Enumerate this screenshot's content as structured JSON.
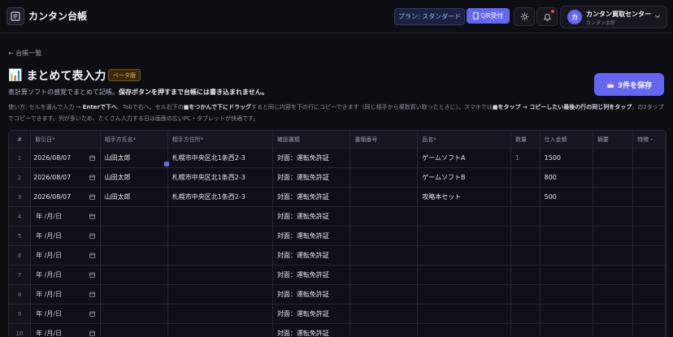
{
  "app": {
    "title": "カンタン台帳"
  },
  "header": {
    "plan_label": "プラン: スタンダード",
    "qr_label": "QR受付",
    "account_name": "カンタン買取センター",
    "account_sub": "カンタン太郎",
    "avatar_letter": "カ"
  },
  "nav": {
    "back_label": "← 台帳一覧"
  },
  "page": {
    "emoji": "📊",
    "title": "まとめて表入力",
    "beta_label": "ベータ版",
    "lead_prefix": "表計算ソフトの感覚でまとめて記帳。",
    "lead_bold": "保存ボタンを押すまで台帳には書き込まれません。",
    "save_label": "3件を保存"
  },
  "usage": {
    "p1": "使い方: セルを選んで入力 → ",
    "b1": "Enterで下へ",
    "p2": "、Tabで右へ。セル右下の",
    "b2": "■をつかんで下にドラッグ",
    "p3": "すると同じ内容を下の行にコピーできます（同じ相手から複数買い取ったときに）。スマホでは",
    "b3": "■をタップ → コピーしたい最後の行の同じ列をタップ",
    "p4": "。の2タップでコピーできます。列が多いため、たくさん入力する日は画面の広いPC・タブレットが快適です。"
  },
  "grid": {
    "columns": [
      "#",
      "取引日*",
      "相手方氏名*",
      "相手方住所*",
      "確認書類",
      "書類番号",
      "品名*",
      "数量",
      "仕入金額",
      "摘要",
      "特徴・"
    ],
    "empty_date": "年 /月/日",
    "rows": [
      {
        "num": "1",
        "date": "2026/08/07",
        "name": "山田太郎",
        "address": "札幌市中央区北1条西2-3",
        "doc": "対面：運転免許証",
        "doc_no": "",
        "item": "ゲームソフトA",
        "qty": "1",
        "price": "1500",
        "memo": "",
        "feature": ""
      },
      {
        "num": "2",
        "date": "2026/08/07",
        "name": "山田太郎",
        "address": "札幌市中央区北1条西2-3",
        "doc": "対面：運転免許証",
        "doc_no": "",
        "item": "ゲームソフトB",
        "qty": "",
        "price": "800",
        "memo": "",
        "feature": ""
      },
      {
        "num": "3",
        "date": "2026/08/07",
        "name": "山田太郎",
        "address": "札幌市中央区北1条西2-3",
        "doc": "対面：運転免許証",
        "doc_no": "",
        "item": "攻略本セット",
        "qty": "",
        "price": "500",
        "memo": "",
        "feature": ""
      },
      {
        "num": "4",
        "date": "",
        "name": "",
        "address": "",
        "doc": "対面：運転免許証",
        "doc_no": "",
        "item": "",
        "qty": "",
        "price": "",
        "memo": "",
        "feature": ""
      },
      {
        "num": "5",
        "date": "",
        "name": "",
        "address": "",
        "doc": "対面：運転免許証",
        "doc_no": "",
        "item": "",
        "qty": "",
        "price": "",
        "memo": "",
        "feature": ""
      },
      {
        "num": "6",
        "date": "",
        "name": "",
        "address": "",
        "doc": "対面：運転免許証",
        "doc_no": "",
        "item": "",
        "qty": "",
        "price": "",
        "memo": "",
        "feature": ""
      },
      {
        "num": "7",
        "date": "",
        "name": "",
        "address": "",
        "doc": "対面：運転免許証",
        "doc_no": "",
        "item": "",
        "qty": "",
        "price": "",
        "memo": "",
        "feature": ""
      },
      {
        "num": "8",
        "date": "",
        "name": "",
        "address": "",
        "doc": "対面：運転免許証",
        "doc_no": "",
        "item": "",
        "qty": "",
        "price": "",
        "memo": "",
        "feature": ""
      },
      {
        "num": "9",
        "date": "",
        "name": "",
        "address": "",
        "doc": "対面：運転免許証",
        "doc_no": "",
        "item": "",
        "qty": "",
        "price": "",
        "memo": "",
        "feature": ""
      },
      {
        "num": "10",
        "date": "",
        "name": "",
        "address": "",
        "doc": "対面：運転免許証",
        "doc_no": "",
        "item": "",
        "qty": "",
        "price": "",
        "memo": "",
        "feature": ""
      }
    ]
  }
}
